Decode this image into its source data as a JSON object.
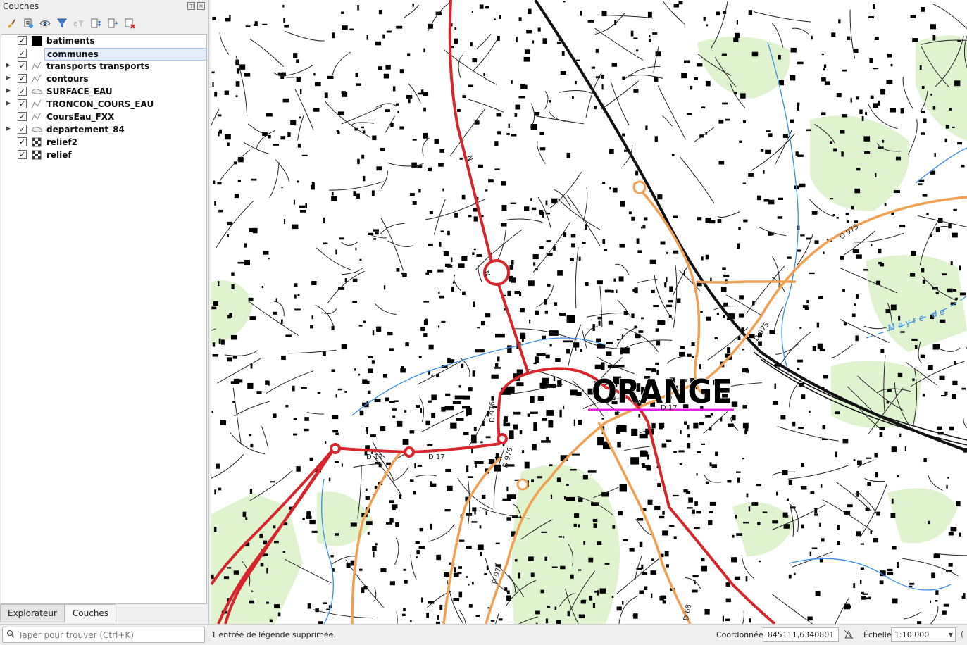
{
  "dock": {
    "title": "Couches",
    "float_glyph": "◫",
    "close_glyph": "×",
    "toolbar_icons": [
      "paint-brush-icon",
      "add-group-icon",
      "eye-icon",
      "filter-icon",
      "expression-filter-icon",
      "expand-all-icon",
      "collapse-all-icon",
      "remove-layer-icon"
    ],
    "layers": [
      {
        "name": "batiments",
        "checked": true,
        "expandable": false,
        "symbol": "fill-black"
      },
      {
        "name": "communes",
        "checked": true,
        "expandable": false,
        "symbol": "none",
        "selected": true
      },
      {
        "name": "transports transports",
        "checked": true,
        "expandable": true,
        "symbol": "line"
      },
      {
        "name": "contours",
        "checked": true,
        "expandable": true,
        "symbol": "line"
      },
      {
        "name": "SURFACE_EAU",
        "checked": true,
        "expandable": true,
        "symbol": "polygon"
      },
      {
        "name": "TRONCON_COURS_EAU",
        "checked": true,
        "expandable": true,
        "symbol": "line"
      },
      {
        "name": "CoursEau_FXX",
        "checked": true,
        "expandable": false,
        "symbol": "line"
      },
      {
        "name": "departement_84",
        "checked": true,
        "expandable": true,
        "symbol": "polygon"
      },
      {
        "name": "relief2",
        "checked": true,
        "expandable": false,
        "symbol": "raster"
      },
      {
        "name": "relief",
        "checked": true,
        "expandable": false,
        "symbol": "raster"
      }
    ],
    "tabs": [
      {
        "label": "Explorateur",
        "active": false
      },
      {
        "label": "Couches",
        "active": true
      }
    ]
  },
  "map": {
    "city_label": "ORANGE",
    "road_labels": [
      "D 975",
      "D 975",
      "D 976",
      "D 976",
      "D 976",
      "D 17",
      "D 17",
      "D 17",
      "D 68",
      "N",
      "N"
    ],
    "water_label": "Mayre de",
    "colors": {
      "background": "#ffffff",
      "buildings": "#000000",
      "green": "#dff3cf",
      "water": "#3a8ee6",
      "national_road": "#d7262b",
      "departmental_road": "#f0a050",
      "railway": "#111111",
      "commune_line": "#e020e0"
    }
  },
  "statusbar": {
    "locator_placeholder": "Taper pour trouver (Ctrl+K)",
    "message": "1 entrée de légende supprimée.",
    "coord_label": "Coordonnée",
    "coord_value": "845111,6340801",
    "scale_label": "Échelle",
    "scale_value": "1:10 000"
  }
}
